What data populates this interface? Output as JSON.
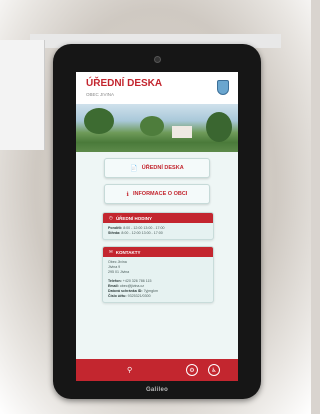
{
  "header": {
    "title": "ÚŘEDNÍ DESKA",
    "subtitle": "OBEC JIVINA"
  },
  "menu": {
    "buttons": [
      {
        "label": "ÚŘEDNÍ DESKA",
        "icon": "document-icon"
      },
      {
        "label": "INFORMACE O OBCI",
        "icon": "info-icon"
      }
    ]
  },
  "office_hours": {
    "title": "ÚŘEDNÍ HODINY",
    "lines": [
      {
        "day": "Pondělí:",
        "hours": "8:00 - 12:00   13:00 - 17:00"
      },
      {
        "day": "Středa:",
        "hours": "8:00 - 12:00   13:00 - 17:00"
      }
    ]
  },
  "contacts": {
    "title": "KONTAKTY",
    "address": [
      "Obec Jivina",
      "Jivina 9",
      "295 01 Jivina"
    ],
    "details": [
      {
        "label": "Telefon:",
        "value": "+420 326 786 115"
      },
      {
        "label": "Email:",
        "value": "obec@jivina.cz"
      },
      {
        "label": "Datová schránka ID:",
        "value": "7yjmgkm"
      },
      {
        "label": "Číslo účtu:",
        "value": "9325321/0300"
      }
    ]
  },
  "footer": {
    "search_icon": "search-icon",
    "buttons": [
      "accessibility-icon",
      "wheelchair-icon"
    ]
  },
  "device": {
    "brand": "Galileo"
  },
  "colors": {
    "accent": "#c3262f",
    "screen_bg": "#eef6f5"
  }
}
